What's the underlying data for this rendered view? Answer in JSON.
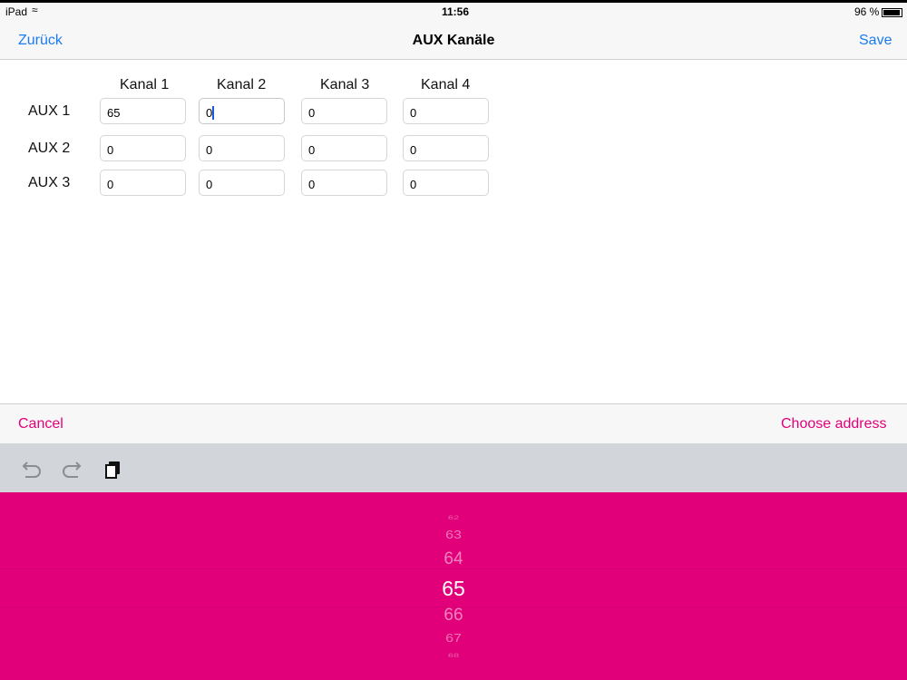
{
  "status": {
    "device": "iPad",
    "time": "11:56",
    "battery": "96 %",
    "battery_level": 0.96
  },
  "nav": {
    "back": "Zurück",
    "title": "AUX Kanäle",
    "save": "Save"
  },
  "grid": {
    "columns": [
      "Kanal 1",
      "Kanal 2",
      "Kanal 3",
      "Kanal 4"
    ],
    "rows": [
      {
        "label": "AUX 1",
        "values": [
          "65",
          "0",
          "0",
          "0"
        ]
      },
      {
        "label": "AUX 2",
        "values": [
          "0",
          "0",
          "0",
          "0"
        ]
      },
      {
        "label": "AUX 3",
        "values": [
          "0",
          "0",
          "0",
          "0"
        ]
      }
    ]
  },
  "accessory": {
    "cancel": "Cancel",
    "choose": "Choose address"
  },
  "toolbar": {
    "undo": "undo-icon",
    "redo": "redo-icon",
    "paste": "paste-icon"
  },
  "picker": {
    "values": [
      "62",
      "63",
      "64",
      "65",
      "66",
      "67",
      "68"
    ],
    "selected": "65"
  },
  "colors": {
    "accent": "#1a7cf0",
    "brand": "#e2007a"
  }
}
